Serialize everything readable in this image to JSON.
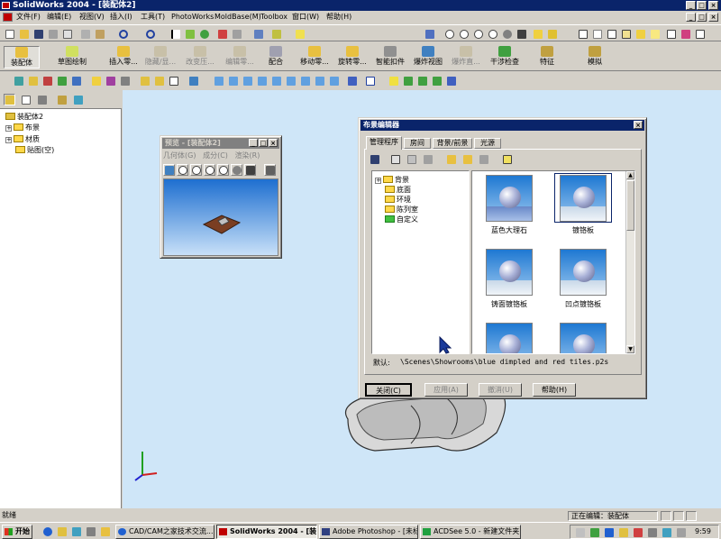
{
  "app": {
    "title": "SolidWorks 2004 - [装配体2]"
  },
  "menu": [
    "文件(F)",
    "编辑(E)",
    "视图(V)",
    "插入(I)",
    "工具(T)",
    "PhotoWorks",
    "MoldBase(M)",
    "Toolbox",
    "窗口(W)",
    "帮助(H)"
  ],
  "command_manager": {
    "tab_assembly": "装配体",
    "tab_sketch": "草图绘制",
    "buttons": [
      {
        "label": "插入零...",
        "enabled": true
      },
      {
        "label": "隐藏/显...",
        "enabled": false
      },
      {
        "label": "改变压...",
        "enabled": false
      },
      {
        "label": "编辑零...",
        "enabled": false
      },
      {
        "label": "配合",
        "enabled": true
      },
      {
        "label": "移动零...",
        "enabled": true
      },
      {
        "label": "旋转零...",
        "enabled": true
      },
      {
        "label": "智能扣件",
        "enabled": true
      },
      {
        "label": "爆炸视图",
        "enabled": true
      },
      {
        "label": "爆炸直...",
        "enabled": false
      },
      {
        "label": "干涉检查",
        "enabled": true
      },
      {
        "label": "特征",
        "enabled": true
      },
      {
        "label": "模拟",
        "enabled": true
      }
    ]
  },
  "tree": {
    "root": "装配体2",
    "items": [
      {
        "label": "布景",
        "expandable": true
      },
      {
        "label": "材质",
        "expandable": true
      },
      {
        "label": "贴图(空)",
        "expandable": false
      }
    ]
  },
  "preview": {
    "title": "预览 - [装配体2]",
    "menu": [
      "几何体(G)",
      "成分(C)",
      "渲染(R)"
    ]
  },
  "scene_editor": {
    "title": "布景编辑器",
    "tabs": [
      "管理程序",
      "房间",
      "背景/前景",
      "光源"
    ],
    "active_tab": 0,
    "folders": [
      "背景",
      "底面",
      "环境",
      "陈列室",
      "自定义"
    ],
    "thumbnails": [
      "蓝色大理石",
      "镀铬板",
      "铸面镀铬板",
      "凹点镀铬板",
      "",
      ""
    ],
    "selected_thumbnail": 1,
    "default_label": "默认:",
    "default_path": "\\Scenes\\Showrooms\\blue dimpled and red tiles.p2s",
    "buttons": {
      "close": "关闭(C)",
      "apply": "应用(A)",
      "cancel": "撤消(U)",
      "help": "帮助(H)"
    }
  },
  "status": {
    "left": "就绪",
    "right": "正在编辑：装配体"
  },
  "taskbar": {
    "start": "开始",
    "tasks": [
      "CAD/CAM之家技术交流...",
      "SolidWorks 2004 - [装配...",
      "Adobe Photoshop - [未标...",
      "ACDSee 5.0 - 新建文件夹"
    ],
    "active_task": 1,
    "clock": "9:59"
  },
  "colors": {
    "titlebar": "#0a246a",
    "viewport": "#cfe6f8",
    "face": "#d4d0c8"
  }
}
